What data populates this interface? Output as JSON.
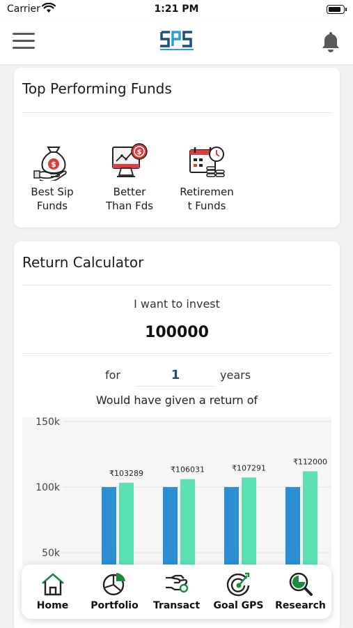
{
  "status_bar": {
    "carrier": "Carrier",
    "time": "1:21 PM",
    "battery_level": 0.9
  },
  "header": {
    "menu_icon": "hamburger-menu-icon",
    "logo_icon": "sps-logo-icon",
    "notification_icon": "bell-icon"
  },
  "top_funds": {
    "title": "Top Performing Funds",
    "items": [
      {
        "label": "Best Sip\nFunds",
        "icon": "money-bag-hand-icon"
      },
      {
        "label": "Better\nThan Fds",
        "icon": "chart-monitor-coin-icon"
      },
      {
        "label": "Retiremen\nt Funds",
        "icon": "calendar-clock-coins-icon"
      }
    ]
  },
  "calculator": {
    "title": "Return Calculator",
    "invest_label": "I want to invest",
    "invest_amount": "100000",
    "for_label": "for",
    "years_value": "1",
    "years_label": "years",
    "return_label": "Would have given a return of"
  },
  "chart_data": {
    "type": "bar",
    "categories": [
      "",
      "",
      "",
      ""
    ],
    "series": [
      {
        "color": "#2b8fd1",
        "values": [
          100000,
          100000,
          100000,
          100000
        ]
      },
      {
        "color": "#5ce0b4",
        "values": [
          103289,
          106031,
          107291,
          112000
        ]
      }
    ],
    "data_labels": [
      "₹103289",
      "₹106031",
      "₹107291",
      "₹112000"
    ],
    "y_ticks": [
      "150k",
      "100k",
      "50k"
    ],
    "y_tick_values": [
      150000,
      100000,
      50000
    ],
    "ylim": [
      0,
      150000
    ],
    "grid": true
  },
  "bottom_nav": {
    "items": [
      {
        "label": "Home",
        "icon": "home-icon"
      },
      {
        "label": "Portfolio",
        "icon": "pie-chart-icon"
      },
      {
        "label": "Transact",
        "icon": "hand-coin-icon"
      },
      {
        "label": "Goal GPS",
        "icon": "target-icon"
      },
      {
        "label": "Research",
        "icon": "magnifier-chart-icon"
      }
    ]
  },
  "colors": {
    "accent_green": "#1b8a3c",
    "bar_blue": "#2b8fd1",
    "bar_green": "#5ce0b4",
    "coin_red": "#e23b3b"
  }
}
